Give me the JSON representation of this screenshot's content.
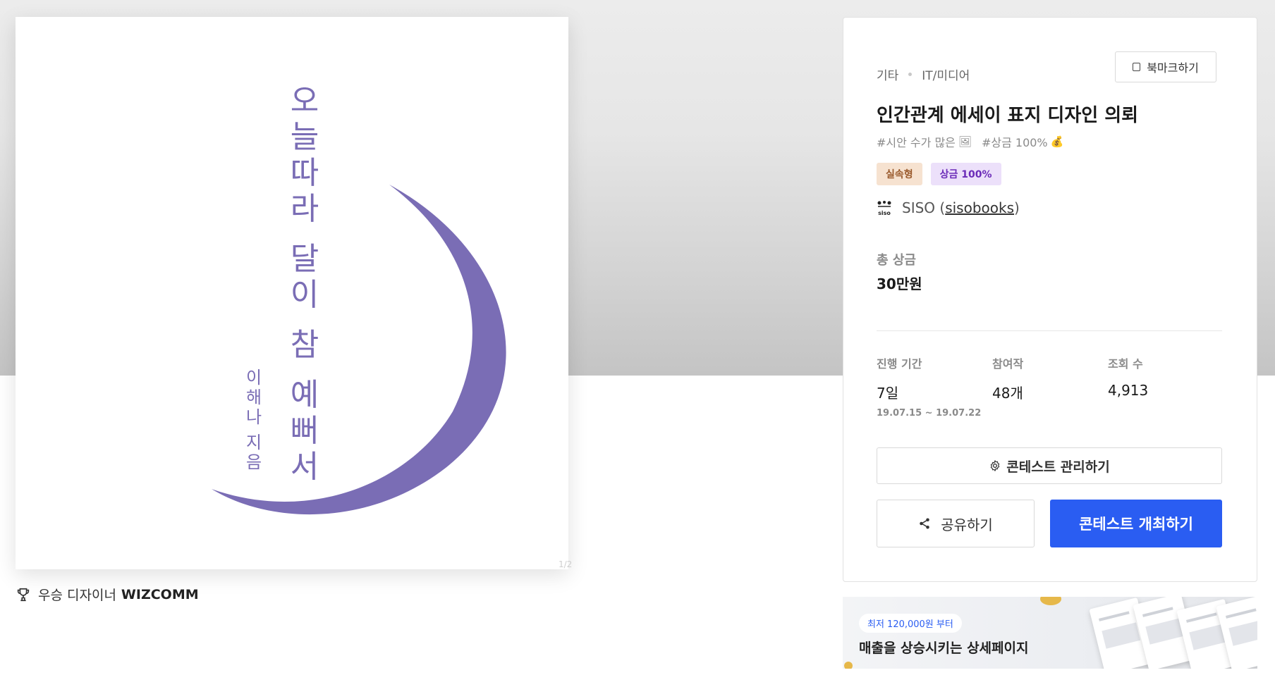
{
  "cover": {
    "title_chars": [
      "오",
      "늘",
      "따",
      "라",
      "",
      "달",
      "이",
      "",
      "참",
      "",
      "예",
      "뻐",
      "서"
    ],
    "author_chars": [
      "이",
      "해",
      "나",
      "",
      "지",
      "음"
    ],
    "watermark": "1/2",
    "accent_color": "#7a6db5"
  },
  "winner": {
    "label": "우승 디자이너",
    "name": "WIZCOMM",
    "icon": "trophy-icon"
  },
  "panel": {
    "category": "기타",
    "subcategory": "IT/미디어",
    "bookmark_label": "북마크하기",
    "title": "인간관계 에세이 표지 디자인 의뢰",
    "tag1": "#시안 수가 많은",
    "tag1_emoji": "🖼",
    "tag2": "#상금 100%",
    "tag2_emoji": "💰",
    "badge1": "실속형",
    "badge2": "상금 100%",
    "host_logo_text": "siso",
    "host_name": "SISO (",
    "host_handle": "sisobooks",
    "host_close": ")",
    "total_label": "총 상금",
    "total_value": "30만원",
    "stats": [
      {
        "label": "진행 기간",
        "value": "7일",
        "range": "19.07.15 ~ 19.07.22"
      },
      {
        "label": "참여작",
        "value": "48개"
      },
      {
        "label": "조회 수",
        "value": "4,913"
      }
    ],
    "manage_label": "콘테스트 관리하기",
    "share_label": "공유하기",
    "host_button_label": "콘테스트 개최하기",
    "primary_color": "#2a5df2"
  },
  "ad": {
    "pill": "최저 120,000원 부터",
    "title": "매출을 상승시키는 상세페이지"
  }
}
